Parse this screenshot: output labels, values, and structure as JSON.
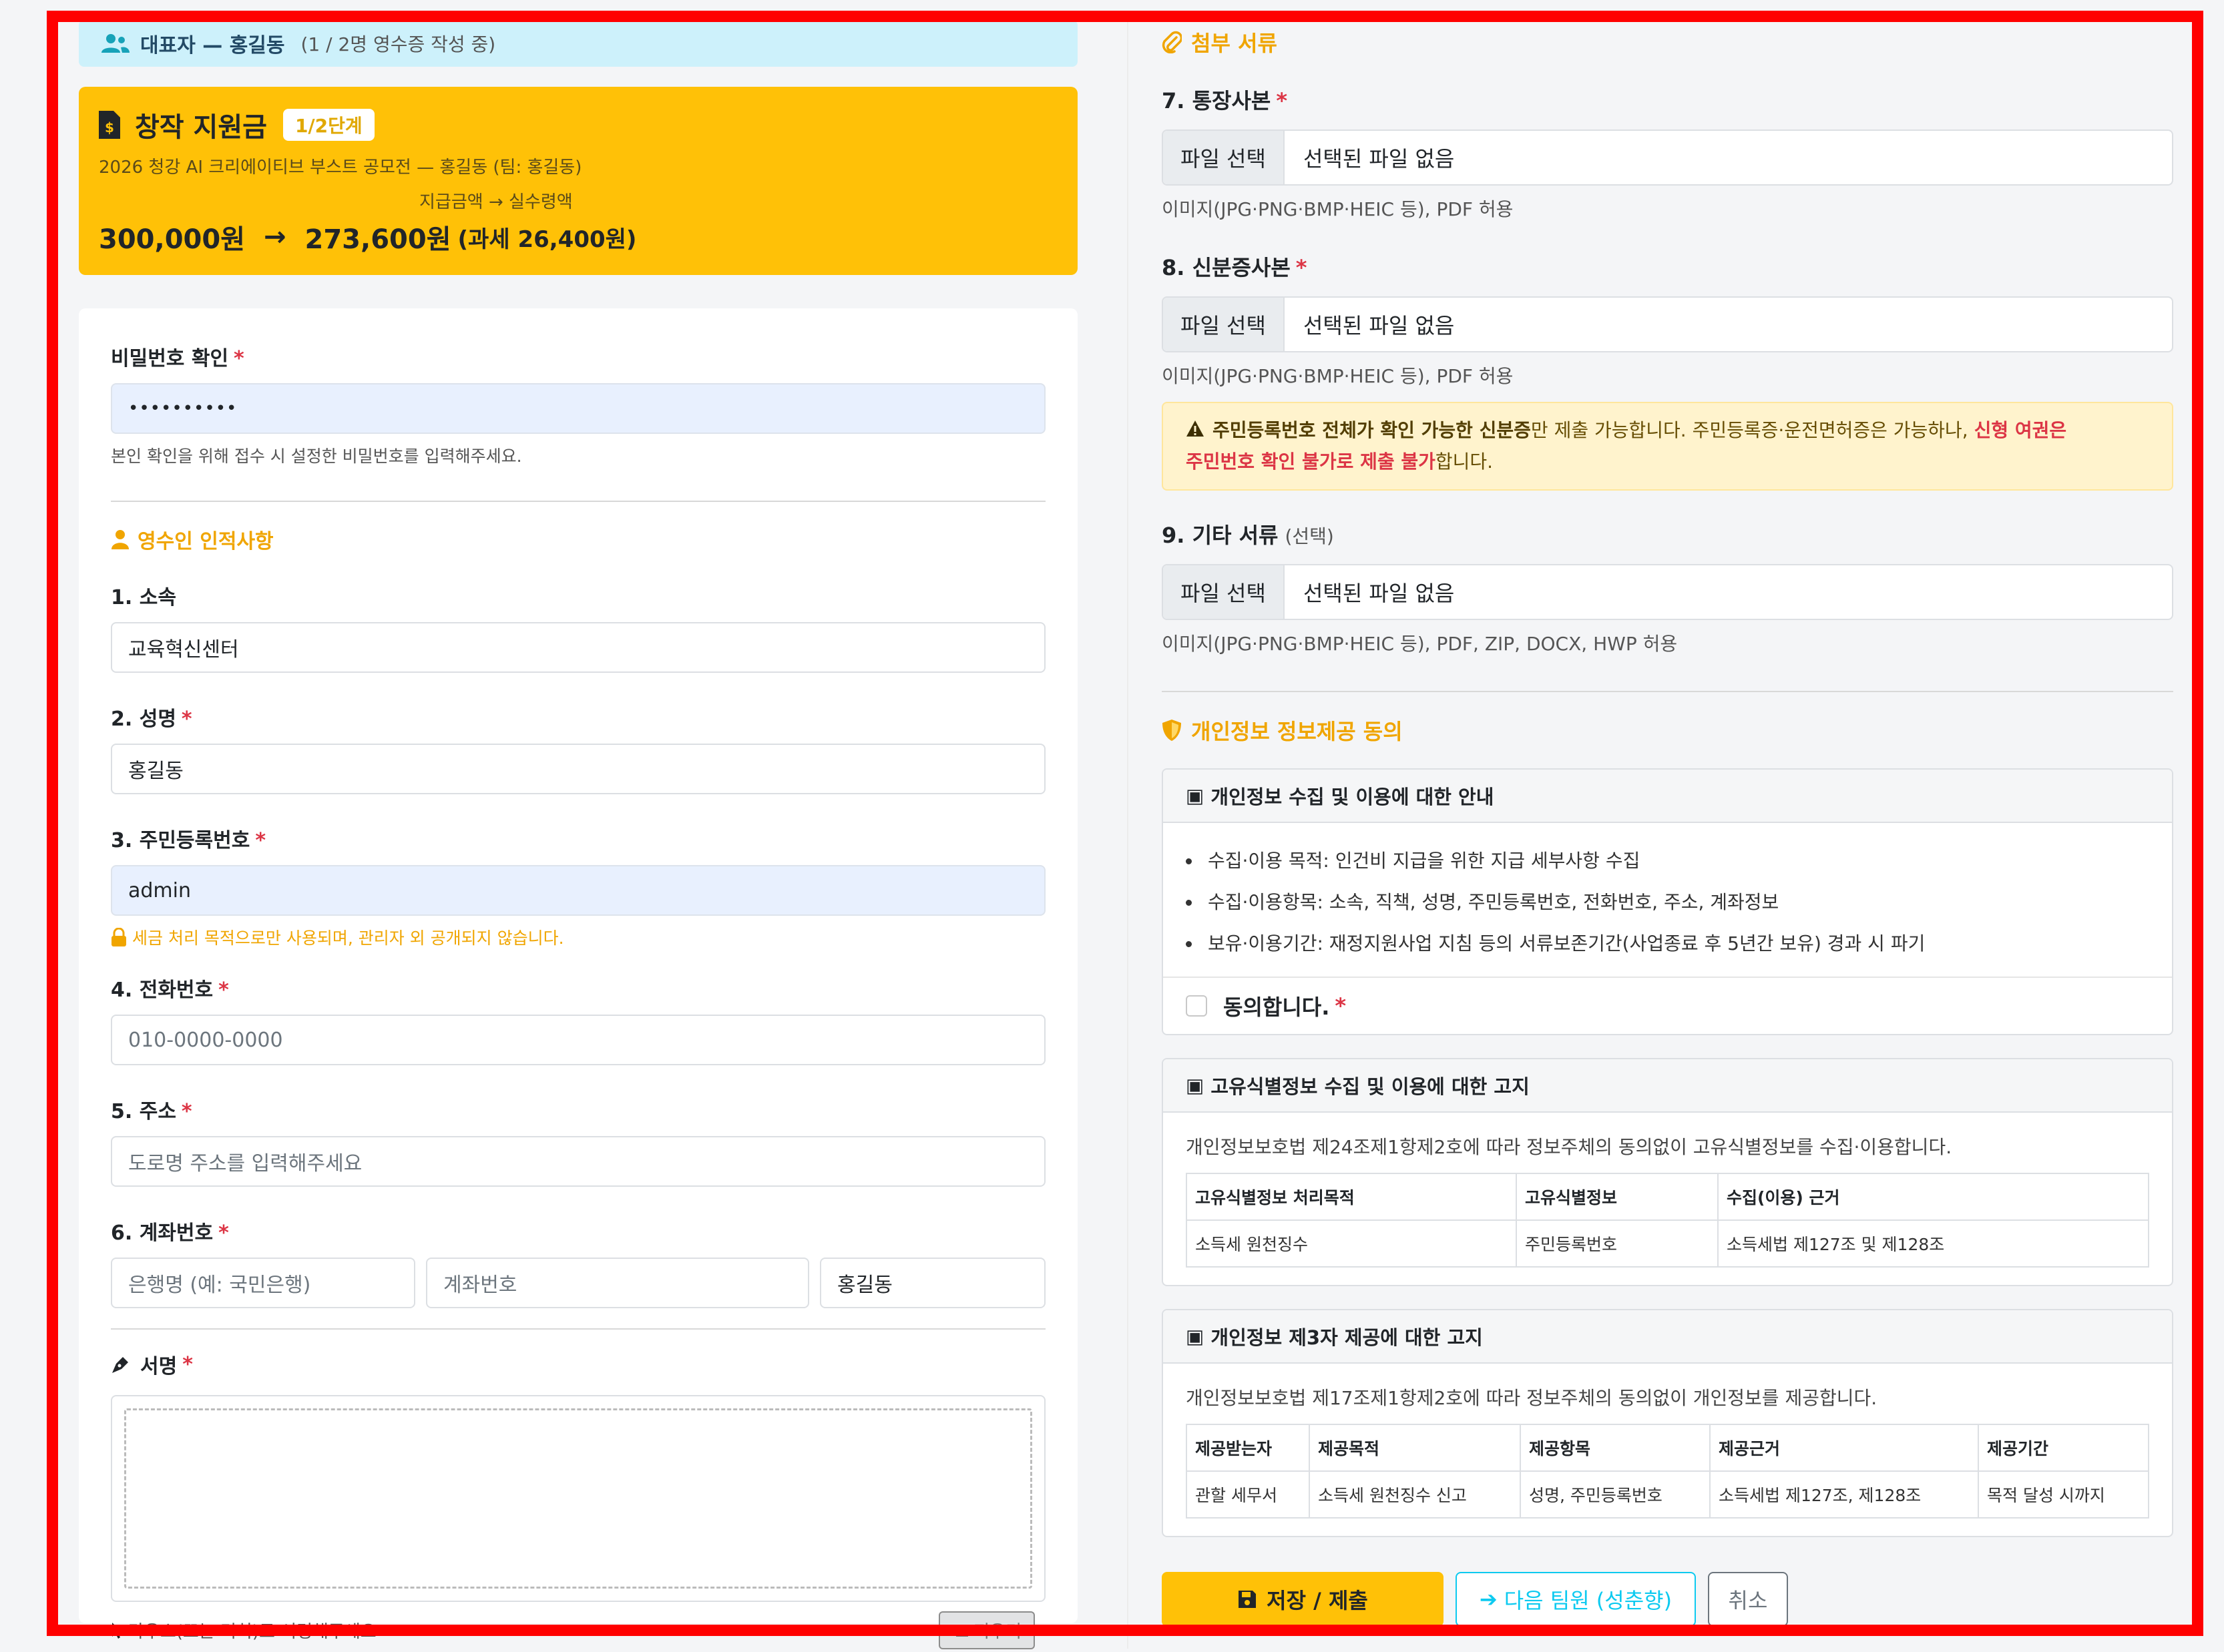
{
  "header": {
    "representative": "대표자 — 홍길동",
    "progress": "(1 / 2명 영수증 작성 중)"
  },
  "grant": {
    "title": "창작 지원금",
    "stage": "1/2단계",
    "subtitle": "2026 청강 AI 크리에이티브 부스트 공모전 — 홍길동 (팀: 홍길동)",
    "amount_label": "지급금액 → 실수령액",
    "gross": "300,000원",
    "arrow": "→",
    "net": "273,600원",
    "tax": "(과세 26,400원)"
  },
  "password": {
    "label": "비밀번호 확인",
    "required_mark": "*",
    "value": "••••••••••",
    "help": "본인 확인을 위해 접수 시 설정한 비밀번호를 입력해주세요."
  },
  "recipient": {
    "section_title": "영수인 인적사항",
    "affiliation": {
      "label": "1. 소속",
      "value": "교육혁신센터"
    },
    "name": {
      "label": "2. 성명",
      "value": "홍길동"
    },
    "rrn": {
      "label": "3. 주민등록번호",
      "value": "admin",
      "notice": "세금 처리 목적으로만 사용되며, 관리자 외 공개되지 않습니다."
    },
    "phone": {
      "label": "4. 전화번호",
      "placeholder": "010-0000-0000"
    },
    "address": {
      "label": "5. 주소",
      "placeholder": "도로명 주소를 입력해주세요"
    },
    "account": {
      "label": "6. 계좌번호",
      "bank_placeholder": "은행명 (예: 국민은행)",
      "number_placeholder": "계좌번호",
      "holder": "홍길동"
    }
  },
  "signature": {
    "label": "서명",
    "hint": "마우스(또는 터치)로 서명해주세요",
    "clear": "지우기"
  },
  "attachments": {
    "section_title": "첨부 서류",
    "file_button": "파일 선택",
    "no_file": "선택된 파일 없음",
    "bankbook": {
      "label": "7. 통장사본",
      "help": "이미지(JPG·PNG·BMP·HEIC 등), PDF 허용"
    },
    "id_copy": {
      "label": "8. 신분증사본",
      "help": "이미지(JPG·PNG·BMP·HEIC 등), PDF 허용"
    },
    "alert": {
      "bold1": "주민등록번호 전체가 확인 가능한 신분증",
      "text1": "만 제출 가능합니다. 주민등록증·운전면허증은 가능하나, ",
      "red1": "신형 여권은",
      "red2": "주민번호 확인 불가로 제출 불가",
      "text2": "합니다."
    },
    "other": {
      "label": "9. 기타 서류",
      "optional": "(선택)",
      "help": "이미지(JPG·PNG·BMP·HEIC 등), PDF, ZIP, DOCX, HWP 허용"
    }
  },
  "privacy": {
    "section_title": "개인정보 정보제공 동의",
    "collection": {
      "title": "개인정보 수집 및 이용에 대한 안내",
      "items": [
        "수집·이용 목적: 인건비 지급을 위한 지급 세부사항 수집",
        "수집·이용항목: 소속, 직책, 성명, 주민등록번호, 전화번호, 주소, 계좌정보",
        "보유·이용기간: 재정지원사업 지침 등의 서류보존기간(사업종료 후 5년간 보유) 경과 시 파기"
      ],
      "agree_label": "동의합니다."
    },
    "unique_id": {
      "title": "고유식별정보 수집 및 이용에 대한 고지",
      "desc": "개인정보보호법 제24조제1항제2호에 따라 정보주체의 동의없이 고유식별정보를 수집·이용합니다.",
      "headers": [
        "고유식별정보 처리목적",
        "고유식별정보",
        "수집(이용) 근거"
      ],
      "row": [
        "소득세 원천징수",
        "주민등록번호",
        "소득세법 제127조 및 제128조"
      ]
    },
    "third_party": {
      "title": "개인정보 제3자 제공에 대한 고지",
      "desc": "개인정보보호법 제17조제1항제2호에 따라 정보주체의 동의없이 개인정보를 제공합니다.",
      "headers": [
        "제공받는자",
        "제공목적",
        "제공항목",
        "제공근거",
        "제공기간"
      ],
      "row": [
        "관할 세무서",
        "소득세 원천징수 신고",
        "성명, 주민등록번호",
        "소득세법 제127조, 제128조",
        "목적 달성 시까지"
      ]
    }
  },
  "actions": {
    "save": "저장 / 제출",
    "next": "다음 팀원 (성춘향)",
    "cancel": "취소"
  },
  "colors": {
    "accent": "#ffc107",
    "info": "#0dcaf0",
    "danger": "#dc3545",
    "highlight": "#ff0000"
  }
}
